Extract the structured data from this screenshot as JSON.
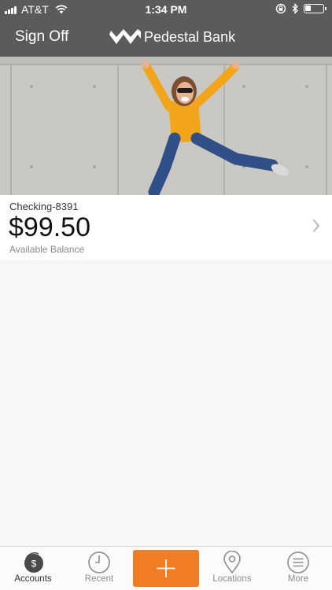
{
  "status_bar": {
    "carrier": "AT&T",
    "time": "1:34 PM"
  },
  "header": {
    "sign_off_label": "Sign Off",
    "brand_name": "Pedestal Bank"
  },
  "account": {
    "name": "Checking-8391",
    "balance": "$99.50",
    "balance_label": "Available Balance"
  },
  "tabbar": {
    "tabs": [
      {
        "label": "Accounts",
        "icon": "dollar-circle-icon",
        "active": true
      },
      {
        "label": "Recent",
        "icon": "clock-icon",
        "active": false
      },
      {
        "label": "",
        "icon": "plus-icon",
        "active": false
      },
      {
        "label": "Locations",
        "icon": "location-pin-icon",
        "active": false
      },
      {
        "label": "More",
        "icon": "menu-icon",
        "active": false
      }
    ]
  },
  "colors": {
    "header_bg": "#5b5b5b",
    "accent": "#f07d24",
    "page_bg": "#f7f7f7"
  }
}
